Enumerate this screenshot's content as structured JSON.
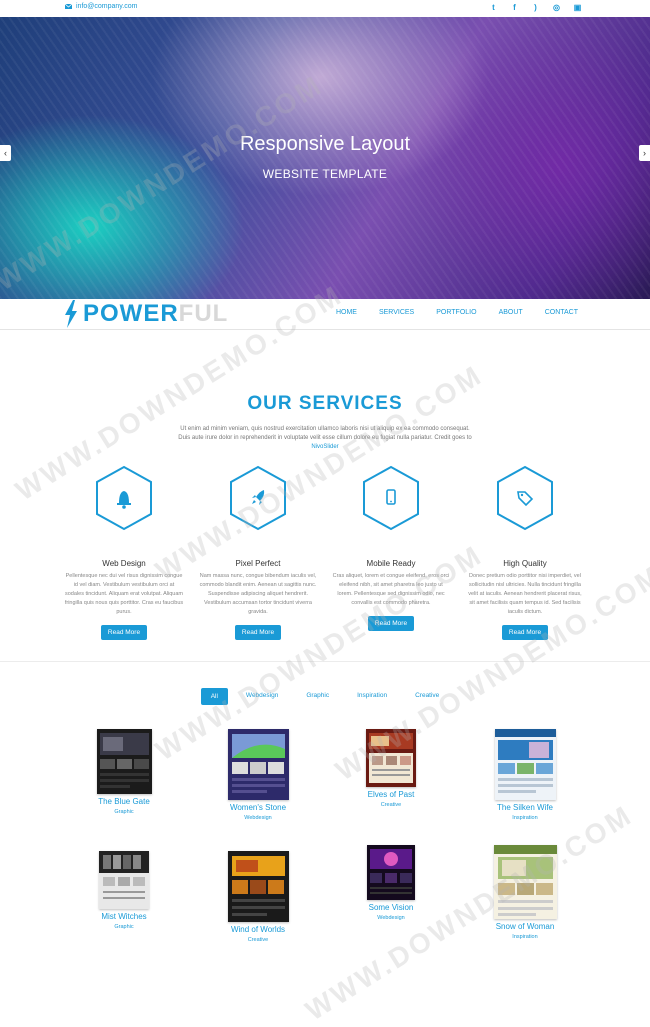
{
  "topbar": {
    "email": "info@company.com",
    "socials": [
      {
        "name": "twitter-icon",
        "glyph": "t"
      },
      {
        "name": "facebook-icon",
        "glyph": "f"
      },
      {
        "name": "rss-icon",
        "glyph": ")"
      },
      {
        "name": "dribbble-icon",
        "glyph": "◎"
      },
      {
        "name": "instagram-icon",
        "glyph": "▣"
      }
    ]
  },
  "hero": {
    "title": "Responsive Layout",
    "subtitle": "WEBSITE TEMPLATE",
    "prev_glyph": "‹",
    "next_glyph": "›"
  },
  "brand": {
    "logo_part1": "POWER",
    "logo_part2": "FUL"
  },
  "nav": [
    "HOME",
    "SERVICES",
    "PORTFOLIO",
    "ABOUT",
    "CONTACT"
  ],
  "services": {
    "title": "OUR SERVICES",
    "description": "Ut enim ad minim veniam, quis nostrud exercitation ullamco laboris nisi ut aliquip ex ea commodo consequat. Duis aute irure dolor in reprehenderit in voluptate velit esse cillum dolore eu fugiat nulla pariatur. Credit goes to",
    "description_link": "NivoSlider",
    "items": [
      {
        "name": "Web Design",
        "icon": "bell-icon",
        "text": "Pellentesque nec dui vel risus dignissim congue id vel diam. Vestibulum vestibulum orci at sodales tincidunt. Aliquam erat volutpat. Aliquam fringilla quis nous quis porttitor. Cras eu faucibus purus.",
        "button": "Read More"
      },
      {
        "name": "Pixel Perfect",
        "icon": "rocket-icon",
        "text": "Nam massa nunc, congue bibendum iaculis vel, commodo blandit enim. Aenean ut sagittis nunc. Suspendisse adipiscing aliquet hendrerit. Vestibulum accumsan tortor tincidunt viverra gravida.",
        "button": "Read More"
      },
      {
        "name": "Mobile Ready",
        "icon": "mobile-icon",
        "text": "Cras aliquet, lorem et congue eleifend, eros orci eleifend nibh, sit amet pharetra leo justo ut lorem. Pellentesque sed dignissim odio, nec convallis est commodo pharetra.",
        "button": "Read More"
      },
      {
        "name": "High Quality",
        "icon": "tag-icon",
        "text": "Donec pretium odio porttitor nisi imperdiet, vel sollicitudin nisl ultricies. Nulla tincidunt fringilla velit at iaculis. Aenean hendrerit placerat risus, sit amet facilisis quam tempus id. Sed facilisis iaculis dictum.",
        "button": "Read More"
      }
    ]
  },
  "portfolio": {
    "filters": [
      "All",
      "Webdesign",
      "Graphic",
      "Inspiration",
      "Creative"
    ],
    "items": [
      {
        "title": "The Blue Gate",
        "category": "Graphic"
      },
      {
        "title": "Women's Stone",
        "category": "Webdesign"
      },
      {
        "title": "Elves of Past",
        "category": "Creative"
      },
      {
        "title": "The Silken Wife",
        "category": "Inspiration"
      },
      {
        "title": "Mist Witches",
        "category": "Graphic"
      },
      {
        "title": "Wind of Worlds",
        "category": "Creative"
      },
      {
        "title": "Some Vision",
        "category": "Webdesign"
      },
      {
        "title": "Snow of Woman",
        "category": "Inspiration"
      }
    ]
  },
  "watermark": "WWW.DOWNDEMO.COM",
  "colors": {
    "accent": "#1a9ad6",
    "muted_logo": "#d8d8d8"
  }
}
